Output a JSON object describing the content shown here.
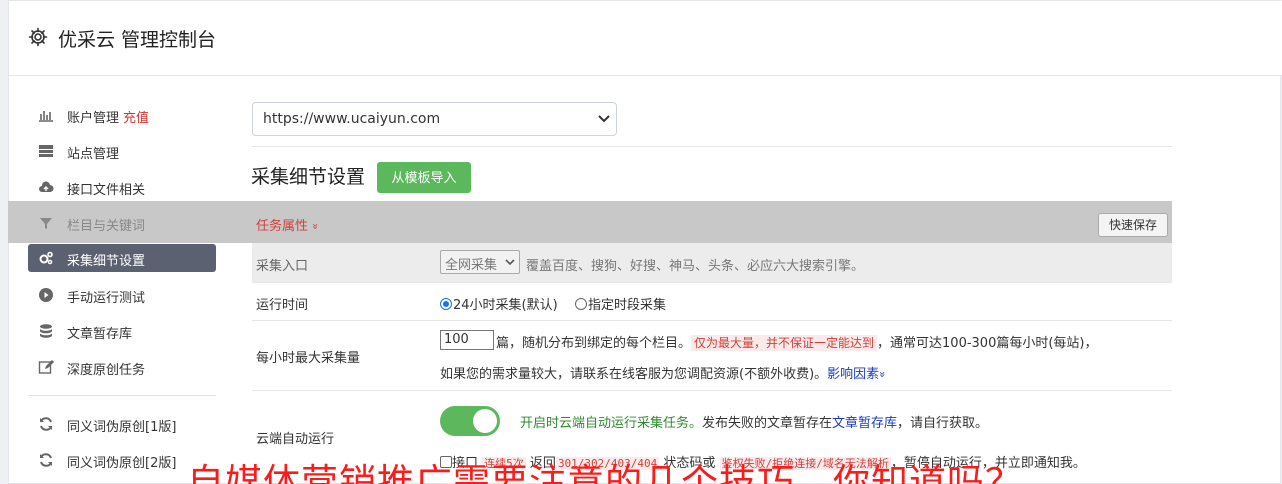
{
  "header": {
    "title": "优采云 管理控制台",
    "icon": "gear-icon"
  },
  "sidebar": {
    "items": [
      {
        "label": "账户管理",
        "extra": "充值",
        "icon": "bar-chart-icon"
      },
      {
        "label": "站点管理",
        "icon": "server-icon"
      },
      {
        "label": "接口文件相关",
        "icon": "cloud-upload-icon"
      },
      {
        "label": "栏目与关键词",
        "icon": "filter-icon"
      },
      {
        "label": "采集细节设置",
        "icon": "cogs-icon"
      },
      {
        "label": "手动运行测试",
        "icon": "play-circle-icon"
      },
      {
        "label": "文章暂存库",
        "icon": "database-icon"
      },
      {
        "label": "深度原创任务",
        "icon": "edit-icon"
      },
      {
        "label": "同义词伪原创[1版]",
        "icon": "refresh-icon"
      },
      {
        "label": "同义词伪原创[2版]",
        "icon": "refresh-icon"
      }
    ]
  },
  "main": {
    "site_select": "https://www.ucaiyun.com",
    "section_title": "采集细节设置",
    "import_button": "从模板导入",
    "task_attr": "任务属性",
    "task_attr_chevron": "»",
    "quick_save": "快速保存",
    "rows": {
      "entry": {
        "label": "采集入口",
        "select_value": "全网采集",
        "desc": "覆盖百度、搜狗、好搜、神马、头条、必应六大搜索引擎。"
      },
      "runtime": {
        "label": "运行时间",
        "option1": "24小时采集(默认)",
        "option2": "指定时段采集"
      },
      "max_per_hour": {
        "label": "每小时最大采集量",
        "value": "100",
        "line1_a": "篇，随机分布到绑定的每个栏目。",
        "line1_tag": "仅为最大量，并不保证一定能达到",
        "line1_b": "，通常可达100-300篇每小时(每站)，",
        "line2_a": "如果您的需求量较大，请联系在线客服为您调配资源(不额外收费)。",
        "line2_link": "影响因素",
        "line2_chevron": "»"
      },
      "cloud_auto": {
        "label": "云端自动运行",
        "desc_green": "开启时云端自动运行采集任务。",
        "desc_a": "发布失败的文章暂存在",
        "desc_link": "文章暂存库",
        "desc_b": "，请自行获取。",
        "line2_a": "接口",
        "line2_tag1": "连续5次",
        "line2_b": "返回",
        "line2_tag2": "301/302/403/404",
        "line2_c": "状态码或",
        "line2_tag3": "鉴权失败/拒绝连接/域名无法解析",
        "line2_d": "，暂停自动运行，并立即通知我。"
      }
    }
  },
  "overlay_text": "自媒体营销推广需要注意的几个技巧，你知道吗？",
  "colors": {
    "accent_green": "#5cb85c",
    "active_item": "#5b6170",
    "alert_red": "#d0403b",
    "link_blue": "#1a39c0"
  }
}
